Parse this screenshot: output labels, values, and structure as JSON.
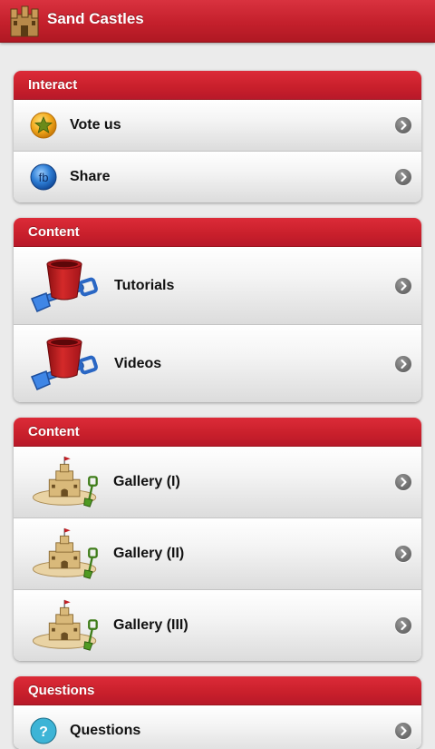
{
  "app": {
    "title": "Sand Castles",
    "icon": "castle-icon"
  },
  "groups": [
    {
      "header": "Interact",
      "items": [
        {
          "label": "Vote us",
          "icon": "star-icon"
        },
        {
          "label": "Share",
          "icon": "facebook-icon"
        }
      ]
    },
    {
      "header": "Content",
      "items": [
        {
          "label": "Tutorials",
          "icon": "bucket-shovel-icon"
        },
        {
          "label": "Videos",
          "icon": "bucket-shovel-icon"
        }
      ]
    },
    {
      "header": "Content",
      "items": [
        {
          "label": "Gallery (I)",
          "icon": "sandcastle-icon"
        },
        {
          "label": "Gallery (II)",
          "icon": "sandcastle-icon"
        },
        {
          "label": "Gallery (III)",
          "icon": "sandcastle-icon"
        }
      ]
    },
    {
      "header": "Questions",
      "items": [
        {
          "label": "Questions",
          "icon": "question-icon"
        }
      ]
    }
  ],
  "colors": {
    "brand_red": "#c81f2b",
    "background": "#ebebeb",
    "chevron_gray": "#6e6e6e"
  }
}
